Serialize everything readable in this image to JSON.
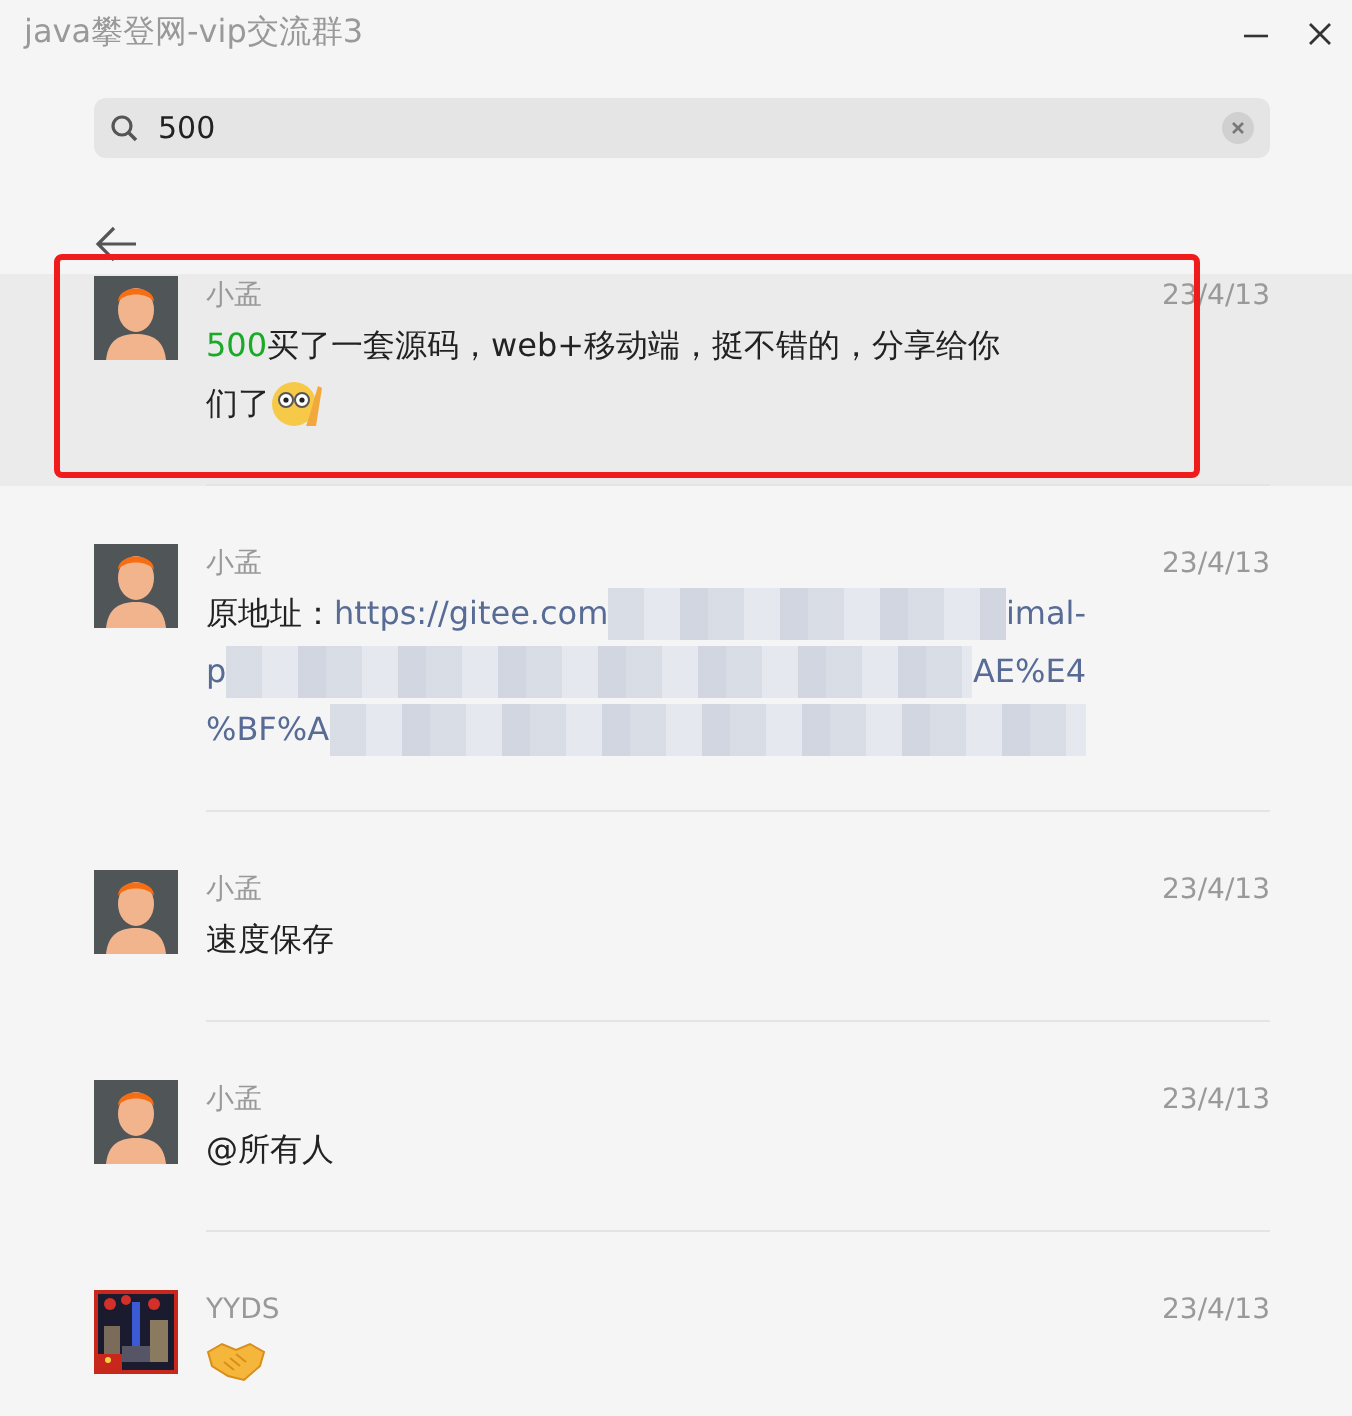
{
  "window": {
    "title": "java攀登网-vip交流群3"
  },
  "search": {
    "value": "500"
  },
  "results": [
    {
      "selected": true,
      "outlined": true,
      "kind": "figure",
      "name": "小孟",
      "date": "23/4/13",
      "lines": [
        [
          {
            "kind": "match",
            "text": "500"
          },
          {
            "kind": "text",
            "text": "买了一套源码，web+移动端，挺不错的，分享给你"
          }
        ],
        [
          {
            "kind": "text",
            "text": "们了"
          },
          {
            "kind": "emoji-face"
          }
        ]
      ]
    },
    {
      "selected": false,
      "outlined": false,
      "kind": "figure",
      "name": "小孟",
      "date": "23/4/13",
      "lines": [
        [
          {
            "kind": "text",
            "text": "原地址："
          },
          {
            "kind": "link",
            "text": "https://gitee.com"
          },
          {
            "kind": "redacted"
          },
          {
            "kind": "link",
            "text": "imal-"
          }
        ],
        [
          {
            "kind": "link",
            "text": "p"
          },
          {
            "kind": "redacted"
          },
          {
            "kind": "link",
            "text": "AE%E4"
          }
        ],
        [
          {
            "kind": "link",
            "text": "%BF%A"
          },
          {
            "kind": "redacted"
          }
        ]
      ]
    },
    {
      "selected": false,
      "outlined": false,
      "kind": "figure",
      "name": "小孟",
      "date": "23/4/13",
      "lines": [
        [
          {
            "kind": "text",
            "text": "速度保存"
          }
        ]
      ]
    },
    {
      "selected": false,
      "outlined": false,
      "kind": "figure",
      "name": "小孟",
      "date": "23/4/13",
      "lines": [
        [
          {
            "kind": "text",
            "text": "@所有人"
          }
        ]
      ]
    },
    {
      "selected": false,
      "outlined": false,
      "kind": "picture",
      "name": "YYDS",
      "date": "23/4/13",
      "lines": [
        [
          {
            "kind": "emoji-handshake"
          }
        ]
      ]
    }
  ]
}
